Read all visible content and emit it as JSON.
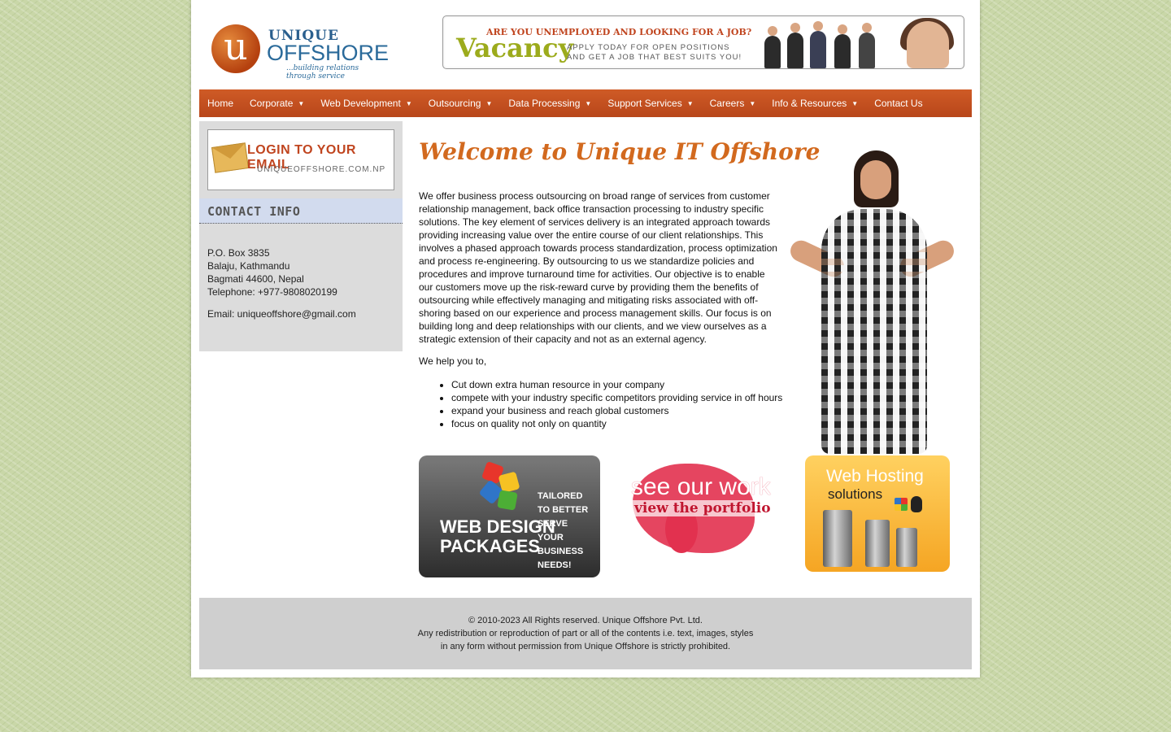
{
  "brand": {
    "logo_letter": "u",
    "name_top": "UNIQUE",
    "name_bottom": "OFFSHORE",
    "tagline": "...building relations through service"
  },
  "banner": {
    "headline": "ARE YOU UNEMPLOYED AND LOOKING FOR A JOB?",
    "title": "Vacancy",
    "sub_line1": "APPLY TODAY FOR OPEN POSITIONS",
    "sub_line2": "AND GET A JOB THAT BEST SUITS YOU!"
  },
  "nav": {
    "items": [
      {
        "label": "Home",
        "has_submenu": false
      },
      {
        "label": "Corporate",
        "has_submenu": true
      },
      {
        "label": "Web Development",
        "has_submenu": true
      },
      {
        "label": "Outsourcing",
        "has_submenu": true
      },
      {
        "label": "Data Processing",
        "has_submenu": true
      },
      {
        "label": "Support Services",
        "has_submenu": true
      },
      {
        "label": "Careers",
        "has_submenu": true
      },
      {
        "label": "Info & Resources",
        "has_submenu": true
      },
      {
        "label": "Contact Us",
        "has_submenu": false
      }
    ]
  },
  "sidebar": {
    "login_title": "LOGIN TO YOUR EMAIL",
    "login_sub": "UNIQUEOFFSHORE.COM.NP",
    "contact_heading": "CONTACT INFO",
    "address_lines": [
      "P.O. Box 3835",
      "Balaju, Kathmandu",
      "Bagmati 44600, Nepal",
      "Telephone: +977-9808020199"
    ],
    "email": "Email: uniqueoffshore@gmail.com"
  },
  "main": {
    "welcome": "Welcome to Unique IT Offshore",
    "intro": "We offer business process outsourcing on broad range of services from customer relationship management, back office transaction processing to industry specific solutions. The key element of services delivery is an integrated approach towards providing increasing value over the entire course of our client relationships. This involves a phased approach towards process standardization, process optimization and process re-engineering. By outsourcing to us we standardize policies and procedures and improve turnaround time for activities. Our objective is to enable our customers move up the risk-reward curve by providing them the benefits of outsourcing while effectively managing and mitigating risks associated with off-shoring based on our experience and process management skills. Our focus is on building long and deep relationships with our clients, and we view ourselves as a strategic extension of their capacity and not as an external agency.",
    "help_intro": "We help you to,",
    "help_items": [
      "Cut down extra human resource in your company",
      "compete with your industry specific competitors providing service in off hours",
      "expand your business and reach global customers",
      "focus on quality not only on quantity"
    ]
  },
  "promos": {
    "web_design_line1": "WEB DESIGN",
    "web_design_line2": "PACKAGES",
    "web_design_tag": "TAILORED TO BETTER SERVE YOUR BUSINESS NEEDS!",
    "portfolio_see": "see our work",
    "portfolio_view": "view the portfolio",
    "hosting_line1": "Web Hosting",
    "hosting_line2": "solutions"
  },
  "footer": {
    "line1": "© 2010-2023 All Rights reserved. Unique Offshore Pvt. Ltd.",
    "line2": "Any redistribution or reproduction of part or all of the contents i.e. text, images, styles",
    "line3": "in any form without permission from Unique Offshore is strictly prohibited."
  },
  "colors": {
    "nav_bg": "#c2501f",
    "accent_orange": "#d2691e",
    "sidebar_bg": "#dcdcdc",
    "footer_bg": "#cfcfcf"
  }
}
